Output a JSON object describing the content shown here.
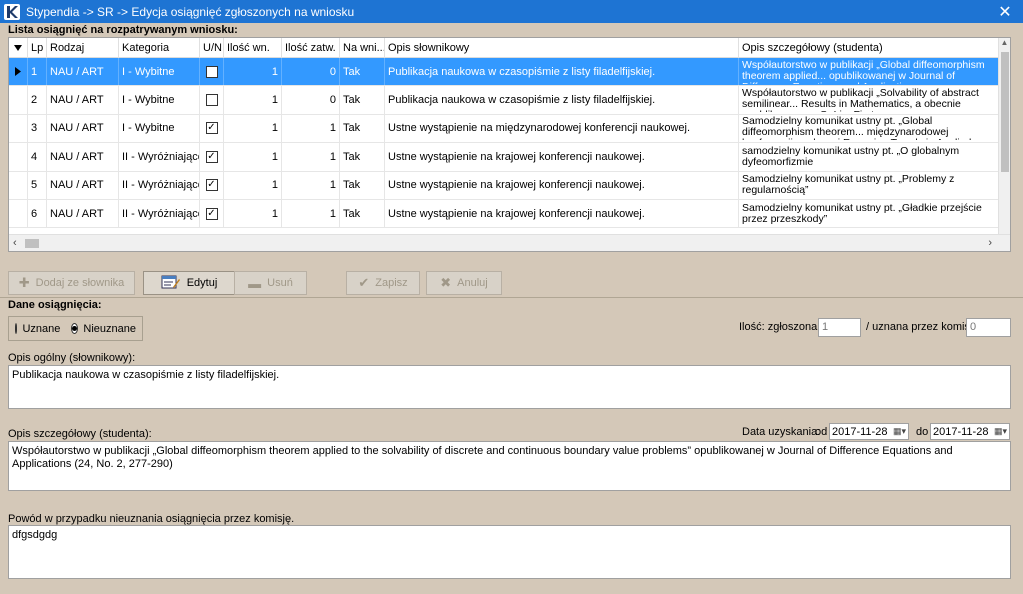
{
  "window": {
    "title": "Stypendia -> SR -> Edycja osiągnięć zgłoszonych na wniosku",
    "icon": "app-logo-icon",
    "close_symbol": "✕"
  },
  "list": {
    "label": "Lista osiągnięć na rozpatrywanym wniosku:",
    "columns": [
      "Lp",
      "Rodzaj",
      "Kategoria",
      "U/N",
      "Ilość wn.",
      "Ilość zatw.",
      "Na wni...",
      "Opis słownikowy",
      "Opis szczegółowy (studenta)"
    ],
    "rows": [
      {
        "lp": "1",
        "rodzaj": "NAU / ART",
        "kategoria": "I - Wybitne",
        "un": false,
        "ilosc_wn": "1",
        "ilosc_zatw": "0",
        "na_wn": "Tak",
        "opis_slownikowy": "Publikacja naukowa w czasopiśmie z listy filadelfijskiej.",
        "opis_szczegolowy": "Współautorstwo w publikacji „Global diffeomorphism theorem applied... opublikowanej w Journal of Difference Equations and Applications"
      },
      {
        "lp": "2",
        "rodzaj": "NAU / ART",
        "kategoria": "I - Wybitne",
        "un": false,
        "ilosc_wn": "1",
        "ilosc_zatw": "0",
        "na_wn": "Tak",
        "opis_slownikowy": "Publikacja naukowa w czasopiśmie z listy filadelfijskiej.",
        "opis_szczegolowy": "Współautorstwo w publikacji „Solvability of abstract semilinear... Results in Mathematics, a obecnie opublikowana w OnLineFirst"
      },
      {
        "lp": "3",
        "rodzaj": "NAU / ART",
        "kategoria": "I - Wybitne",
        "un": true,
        "ilosc_wn": "1",
        "ilosc_zatw": "1",
        "na_wn": "Tak",
        "opis_slownikowy": "Ustne wystąpienie na międzynarodowej konferencji naukowej.",
        "opis_szczegolowy": "Samodzielny komunikat ustny pt. „Global diffeomorphism theorem... międzynarodowej konferencji naukowej Emerging Trends in Applied"
      },
      {
        "lp": "4",
        "rodzaj": "NAU / ART",
        "kategoria": "II - Wyróżniające",
        "un": true,
        "ilosc_wn": "1",
        "ilosc_zatw": "1",
        "na_wn": "Tak",
        "opis_slownikowy": "Ustne wystąpienie na krajowej konferencji naukowej.",
        "opis_szczegolowy": "samodzielny komunikat ustny pt. „O globalnym dyfeomorfizmie"
      },
      {
        "lp": "5",
        "rodzaj": "NAU / ART",
        "kategoria": "II - Wyróżniające",
        "un": true,
        "ilosc_wn": "1",
        "ilosc_zatw": "1",
        "na_wn": "Tak",
        "opis_slownikowy": "Ustne wystąpienie na krajowej konferencji naukowej.",
        "opis_szczegolowy": "Samodzielny komunikat ustny pt. „Problemy z regularnością”"
      },
      {
        "lp": "6",
        "rodzaj": "NAU / ART",
        "kategoria": "II - Wyróżniające",
        "un": true,
        "ilosc_wn": "1",
        "ilosc_zatw": "1",
        "na_wn": "Tak",
        "opis_slownikowy": "Ustne wystąpienie na krajowej konferencji naukowej.",
        "opis_szczegolowy": "Samodzielny komunikat ustny pt. „Gładkie przejście przez przeszkody”"
      }
    ],
    "selected_row": 0
  },
  "toolbar": {
    "add": "Dodaj ze słownika",
    "edit": "Edytuj",
    "delete": "Usuń",
    "save": "Zapisz",
    "cancel": "Anuluj"
  },
  "details": {
    "label": "Dane osiągnięcia:",
    "radio_accepted": "Uznane",
    "radio_rejected": "Nieuznane",
    "selected_radio": "Nieuznane",
    "qty_label": "Ilość: zgłoszona",
    "qty_reported": "1",
    "qty_accepted_label": "/ uznana przez komisję",
    "qty_accepted": "0",
    "general_label": "Opis ogólny (słownikowy):",
    "general_value": "Publikacja naukowa w czasopiśmie z listy filadelfijskiej.",
    "detail_label": "Opis szczegółowy (studenta):",
    "detail_value": "Współautorstwo w publikacji „Global diffeomorphism theorem applied to the solvability of discrete and continuous boundary value problems” opublikowanej w Journal of Difference Equations and Applications (24, No. 2, 277-290)",
    "date_label": "Data uzyskania:",
    "date_from_label": "od",
    "date_from": "2017-11-28",
    "date_to_label": "do",
    "date_to": "2017-11-28",
    "reason_label": "Powód w przypadku nieuznania osiągnięcia przez komisję.",
    "reason_value": "dfgsdgdg"
  },
  "colors": {
    "titlebar": "#1e74d3",
    "background": "#d4c8b8",
    "selection": "#3399ff"
  }
}
